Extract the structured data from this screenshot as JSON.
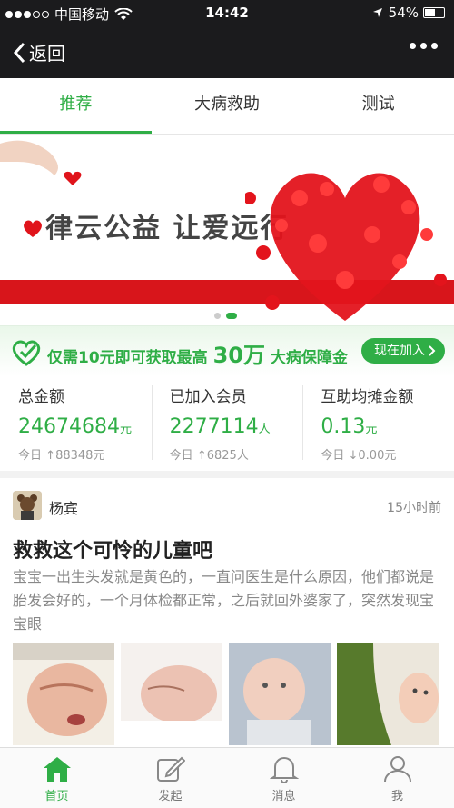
{
  "status_bar": {
    "carrier": "中国移动",
    "time": "14:42",
    "battery": "54%",
    "battery_level": 0.54
  },
  "nav": {
    "back_label": "返回",
    "more_icon": "more-icon"
  },
  "tabs": [
    {
      "label": "推荐",
      "active": true
    },
    {
      "label": "大病救助",
      "active": false
    },
    {
      "label": "测试",
      "active": false
    }
  ],
  "banner": {
    "slogan": "律云公益 让爱远行",
    "page_count": 2,
    "current_page": 2
  },
  "promo": {
    "text_prefix": "仅需10元即可获取最高",
    "highlight": "30万",
    "text_suffix": "大病保障金",
    "join_label": "现在加入"
  },
  "stats": [
    {
      "title": "总金额",
      "value": "24674684",
      "unit": "元",
      "daily_prefix": "今日",
      "daily_arrow": "↑",
      "daily_value": "88348元"
    },
    {
      "title": "已加入会员",
      "value": "2277114",
      "unit": "人",
      "daily_prefix": "今日",
      "daily_arrow": "↑",
      "daily_value": "6825人"
    },
    {
      "title": "互助均摊金额",
      "value": "0.13",
      "unit": "元",
      "daily_prefix": "今日",
      "daily_arrow": "↓",
      "daily_value": "0.00元"
    }
  ],
  "post": {
    "author": "杨宾",
    "time": "15小时前",
    "title": "救救这个可怜的儿童吧",
    "body": "宝宝一出生头发就是黄色的，一直问医生是什么原因，他们都说是胎发会好的，一个月体检都正常，之后就回外婆家了，突然发现宝宝眼"
  },
  "tabbar": [
    {
      "label": "首页",
      "icon": "home-icon",
      "active": true
    },
    {
      "label": "发起",
      "icon": "compose-icon",
      "active": false
    },
    {
      "label": "消息",
      "icon": "bell-icon",
      "active": false
    },
    {
      "label": "我",
      "icon": "person-icon",
      "active": false
    }
  ],
  "colors": {
    "accent": "#2fae46",
    "nav_bg": "#1b1b1d",
    "ribbon": "#d8151b"
  }
}
